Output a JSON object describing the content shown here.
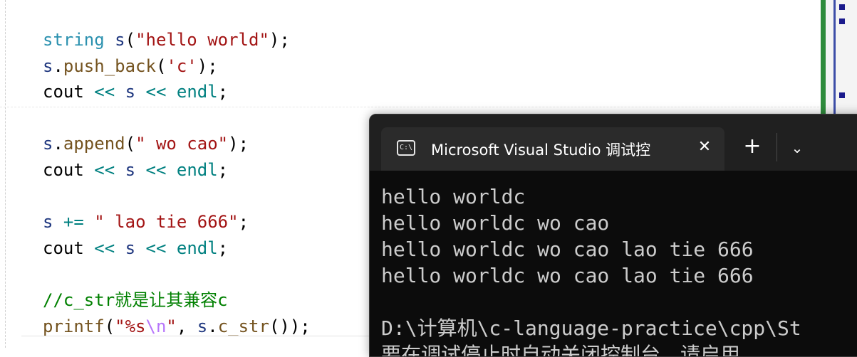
{
  "editor": {
    "lines": [
      "",
      "string s(\"hello world\");",
      "s.push_back('c');",
      "cout << s << endl;",
      "",
      "s.append(\" wo cao\");",
      "cout << s << endl;",
      "",
      "s += \" lao tie 666\";",
      "cout << s << endl;",
      "",
      "//c_str就是让其兼容c",
      "printf(\"%s\\n\", s.c_str());"
    ],
    "tokens": {
      "string": "string",
      "s": "s",
      "open_paren": "(",
      "close_paren": ")",
      "semicolon": ";",
      "dot": ".",
      "comma": ", ",
      "space": " ",
      "str_hello": "\"hello world\"",
      "push_back": "push_back",
      "char_c": "'c'",
      "cout": "cout",
      "shift": "<<",
      "endl": "endl",
      "append": "append",
      "str_wocao": "\" wo cao\"",
      "plus_eq": "+=",
      "str_laotie": "\" lao tie 666\"",
      "comment": "//c_str就是让其兼容c",
      "printf": "printf",
      "fmt_start": "\"%s",
      "fmt_esc": "\\n",
      "fmt_end": "\"",
      "c_str": "c_str",
      "call_empty": "()"
    }
  },
  "terminal": {
    "tab_icon_text": "C:\\",
    "tab_title": "Microsoft Visual Studio 调试控",
    "close_glyph": "✕",
    "new_tab_glyph": "+",
    "dropdown_glyph": "⌄",
    "output_lines": [
      "hello worldc",
      "hello worldc wo cao",
      "hello worldc wo cao lao tie 666",
      "hello worldc wo cao lao tie 666",
      "",
      "D:\\计算机\\c-language-practice\\cpp\\St",
      "要在调试停止时自动关闭控制台，请启用"
    ]
  },
  "colors": {
    "type": "#2b91af",
    "function": "#74531f",
    "string": "#a31515",
    "escape": "#b776fb",
    "operator": "#008080",
    "variable": "#1f377f",
    "comment": "#008000",
    "terminal_bg": "#0c0c0c",
    "terminal_text": "#cccccc"
  }
}
